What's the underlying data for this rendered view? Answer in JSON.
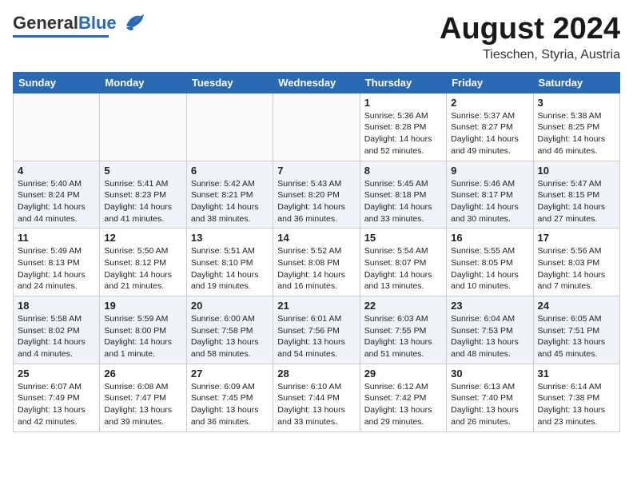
{
  "header": {
    "logo_general": "General",
    "logo_blue": "Blue",
    "month_title": "August 2024",
    "location": "Tieschen, Styria, Austria"
  },
  "weekdays": [
    "Sunday",
    "Monday",
    "Tuesday",
    "Wednesday",
    "Thursday",
    "Friday",
    "Saturday"
  ],
  "weeks": [
    [
      {
        "day": "",
        "info": ""
      },
      {
        "day": "",
        "info": ""
      },
      {
        "day": "",
        "info": ""
      },
      {
        "day": "",
        "info": ""
      },
      {
        "day": "1",
        "info": "Sunrise: 5:36 AM\nSunset: 8:28 PM\nDaylight: 14 hours\nand 52 minutes."
      },
      {
        "day": "2",
        "info": "Sunrise: 5:37 AM\nSunset: 8:27 PM\nDaylight: 14 hours\nand 49 minutes."
      },
      {
        "day": "3",
        "info": "Sunrise: 5:38 AM\nSunset: 8:25 PM\nDaylight: 14 hours\nand 46 minutes."
      }
    ],
    [
      {
        "day": "4",
        "info": "Sunrise: 5:40 AM\nSunset: 8:24 PM\nDaylight: 14 hours\nand 44 minutes."
      },
      {
        "day": "5",
        "info": "Sunrise: 5:41 AM\nSunset: 8:23 PM\nDaylight: 14 hours\nand 41 minutes."
      },
      {
        "day": "6",
        "info": "Sunrise: 5:42 AM\nSunset: 8:21 PM\nDaylight: 14 hours\nand 38 minutes."
      },
      {
        "day": "7",
        "info": "Sunrise: 5:43 AM\nSunset: 8:20 PM\nDaylight: 14 hours\nand 36 minutes."
      },
      {
        "day": "8",
        "info": "Sunrise: 5:45 AM\nSunset: 8:18 PM\nDaylight: 14 hours\nand 33 minutes."
      },
      {
        "day": "9",
        "info": "Sunrise: 5:46 AM\nSunset: 8:17 PM\nDaylight: 14 hours\nand 30 minutes."
      },
      {
        "day": "10",
        "info": "Sunrise: 5:47 AM\nSunset: 8:15 PM\nDaylight: 14 hours\nand 27 minutes."
      }
    ],
    [
      {
        "day": "11",
        "info": "Sunrise: 5:49 AM\nSunset: 8:13 PM\nDaylight: 14 hours\nand 24 minutes."
      },
      {
        "day": "12",
        "info": "Sunrise: 5:50 AM\nSunset: 8:12 PM\nDaylight: 14 hours\nand 21 minutes."
      },
      {
        "day": "13",
        "info": "Sunrise: 5:51 AM\nSunset: 8:10 PM\nDaylight: 14 hours\nand 19 minutes."
      },
      {
        "day": "14",
        "info": "Sunrise: 5:52 AM\nSunset: 8:08 PM\nDaylight: 14 hours\nand 16 minutes."
      },
      {
        "day": "15",
        "info": "Sunrise: 5:54 AM\nSunset: 8:07 PM\nDaylight: 14 hours\nand 13 minutes."
      },
      {
        "day": "16",
        "info": "Sunrise: 5:55 AM\nSunset: 8:05 PM\nDaylight: 14 hours\nand 10 minutes."
      },
      {
        "day": "17",
        "info": "Sunrise: 5:56 AM\nSunset: 8:03 PM\nDaylight: 14 hours\nand 7 minutes."
      }
    ],
    [
      {
        "day": "18",
        "info": "Sunrise: 5:58 AM\nSunset: 8:02 PM\nDaylight: 14 hours\nand 4 minutes."
      },
      {
        "day": "19",
        "info": "Sunrise: 5:59 AM\nSunset: 8:00 PM\nDaylight: 14 hours\nand 1 minute."
      },
      {
        "day": "20",
        "info": "Sunrise: 6:00 AM\nSunset: 7:58 PM\nDaylight: 13 hours\nand 58 minutes."
      },
      {
        "day": "21",
        "info": "Sunrise: 6:01 AM\nSunset: 7:56 PM\nDaylight: 13 hours\nand 54 minutes."
      },
      {
        "day": "22",
        "info": "Sunrise: 6:03 AM\nSunset: 7:55 PM\nDaylight: 13 hours\nand 51 minutes."
      },
      {
        "day": "23",
        "info": "Sunrise: 6:04 AM\nSunset: 7:53 PM\nDaylight: 13 hours\nand 48 minutes."
      },
      {
        "day": "24",
        "info": "Sunrise: 6:05 AM\nSunset: 7:51 PM\nDaylight: 13 hours\nand 45 minutes."
      }
    ],
    [
      {
        "day": "25",
        "info": "Sunrise: 6:07 AM\nSunset: 7:49 PM\nDaylight: 13 hours\nand 42 minutes."
      },
      {
        "day": "26",
        "info": "Sunrise: 6:08 AM\nSunset: 7:47 PM\nDaylight: 13 hours\nand 39 minutes."
      },
      {
        "day": "27",
        "info": "Sunrise: 6:09 AM\nSunset: 7:45 PM\nDaylight: 13 hours\nand 36 minutes."
      },
      {
        "day": "28",
        "info": "Sunrise: 6:10 AM\nSunset: 7:44 PM\nDaylight: 13 hours\nand 33 minutes."
      },
      {
        "day": "29",
        "info": "Sunrise: 6:12 AM\nSunset: 7:42 PM\nDaylight: 13 hours\nand 29 minutes."
      },
      {
        "day": "30",
        "info": "Sunrise: 6:13 AM\nSunset: 7:40 PM\nDaylight: 13 hours\nand 26 minutes."
      },
      {
        "day": "31",
        "info": "Sunrise: 6:14 AM\nSunset: 7:38 PM\nDaylight: 13 hours\nand 23 minutes."
      }
    ]
  ]
}
